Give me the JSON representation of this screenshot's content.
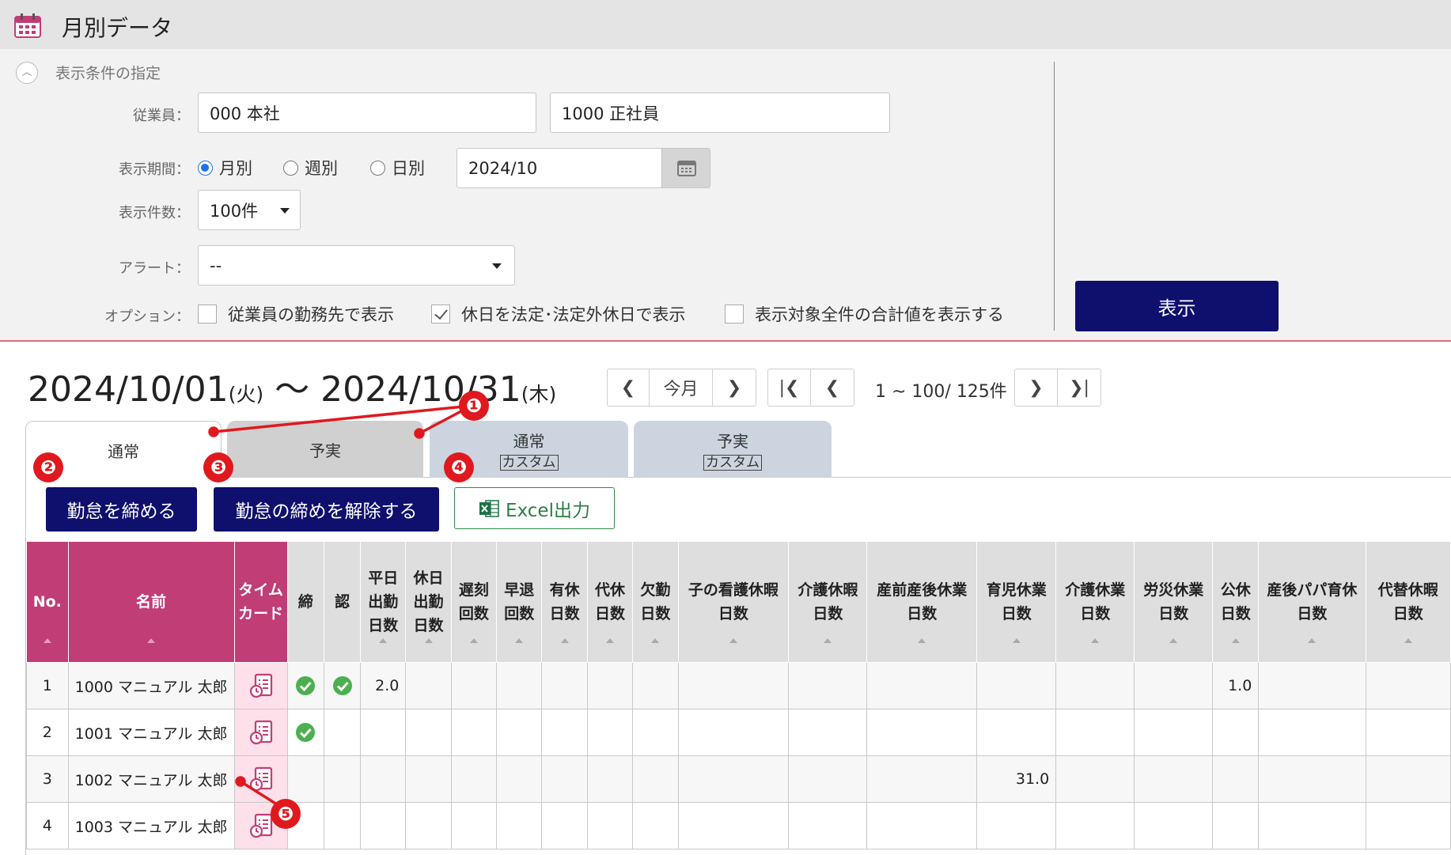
{
  "app": {
    "title": "月別データ"
  },
  "conditions": {
    "section_label": "表示条件の指定",
    "employee_label": "従業員：",
    "employee_office": "000 本社",
    "employee_type": "1000 正社員",
    "period_label": "表示期間：",
    "period_options": [
      "月別",
      "週別",
      "日別"
    ],
    "period_selected": "月別",
    "period_value": "2024/10",
    "count_label": "表示件数：",
    "count_value": "100件",
    "alert_label": "アラート：",
    "alert_value": "--",
    "option_label": "オプション：",
    "options": [
      {
        "label": "従業員の勤務先で表示",
        "checked": false
      },
      {
        "label": "休日を法定･法定外休日で表示",
        "checked": true
      },
      {
        "label": "表示対象全件の合計値を表示する",
        "checked": false
      }
    ],
    "show_button": "表示"
  },
  "period_header": {
    "start": "2024/10/01",
    "start_day": "(火)",
    "separator": "～",
    "end": "2024/10/31",
    "end_day": "(木)"
  },
  "pager": {
    "today": "今月",
    "info": "1 ~ 100/ 125件"
  },
  "tabs": [
    {
      "label": "通常",
      "sub": "",
      "active": true
    },
    {
      "label": "予実",
      "sub": "",
      "active": false
    },
    {
      "label": "通常",
      "sub": "カスタム",
      "active": false
    },
    {
      "label": "予実",
      "sub": "カスタム",
      "active": false
    }
  ],
  "actions": {
    "close": "勤怠を締める",
    "unclose": "勤怠の締めを解除する",
    "excel": "Excel出力"
  },
  "table": {
    "columns": [
      "No.",
      "名前",
      "タイム\nカード",
      "締",
      "認",
      "平日\n出勤\n日数",
      "休日\n出勤\n日数",
      "遅刻\n回数",
      "早退\n回数",
      "有休\n日数",
      "代休\n日数",
      "欠勤\n日数",
      "子の看護休暇\n日数",
      "介護休暇\n日数",
      "産前産後休業\n日数",
      "育児休業\n日数",
      "介護休業\n日数",
      "労災休業\n日数",
      "公休\n日数",
      "産後パパ育休\n日数",
      "代替休暇\n日数"
    ],
    "rows": [
      {
        "no": "1",
        "name": "1000 マニュアル 太郎",
        "closed": true,
        "approved": true,
        "cells": [
          "2.0",
          "",
          "",
          "",
          "",
          "",
          "",
          "",
          "",
          "",
          "",
          "",
          "",
          "1.0",
          "",
          ""
        ]
      },
      {
        "no": "2",
        "name": "1001 マニュアル 太郎",
        "closed": true,
        "approved": false,
        "cells": [
          "",
          "",
          "",
          "",
          "",
          "",
          "",
          "",
          "",
          "",
          "",
          "",
          "",
          "",
          "",
          ""
        ]
      },
      {
        "no": "3",
        "name": "1002 マニュアル 太郎",
        "closed": false,
        "approved": false,
        "cells": [
          "",
          "",
          "",
          "",
          "",
          "",
          "",
          "",
          "",
          "",
          "31.0",
          "",
          "",
          "",
          "",
          ""
        ]
      },
      {
        "no": "4",
        "name": "1003 マニュアル 太郎",
        "closed": false,
        "approved": false,
        "cells": [
          "",
          "",
          "",
          "",
          "",
          "",
          "",
          "",
          "",
          "",
          "",
          "",
          "",
          "",
          "",
          ""
        ]
      }
    ]
  },
  "annotations": [
    "❶",
    "❷",
    "❸",
    "❹",
    "❺"
  ],
  "colors": {
    "navy": "#0f0f6e",
    "pink_header": "#c13d76",
    "timecard_bg": "#fde0ea",
    "badge": "#e0191e"
  }
}
